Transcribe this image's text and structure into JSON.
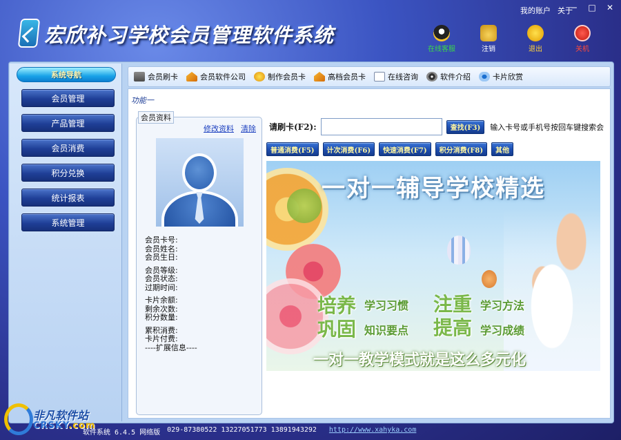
{
  "window": {
    "title": "宏欣补习学校会员管理软件系统",
    "links": [
      "我的账户",
      "关于"
    ],
    "controls": [
      "−",
      "□",
      "✕"
    ]
  },
  "top_actions": [
    {
      "label": "在线客服",
      "icon": "qq-penguin-icon",
      "color": "#3bd64a"
    },
    {
      "label": "注销",
      "icon": "lock-icon",
      "color": "#ffffff"
    },
    {
      "label": "退出",
      "icon": "running-man-icon",
      "color": "#ffd23a"
    },
    {
      "label": "关机",
      "icon": "power-icon",
      "color": "#ff4a3a"
    }
  ],
  "sidebar": {
    "header": "系统导航",
    "items": [
      "会员管理",
      "产品管理",
      "会员消费",
      "积分兑换",
      "统计报表",
      "系统管理"
    ]
  },
  "toolbar": {
    "items": [
      {
        "label": "会员刷卡",
        "icon": "card-reader-icon"
      },
      {
        "label": "会员软件公司",
        "icon": "house-icon"
      },
      {
        "label": "制作会员卡",
        "icon": "star-badge-icon"
      },
      {
        "label": "高档会员卡",
        "icon": "house-icon"
      },
      {
        "label": "在线咨询",
        "icon": "mail-icon"
      },
      {
        "label": "软件介绍",
        "icon": "disc-icon"
      },
      {
        "label": "卡片欣赏",
        "icon": "eye-icon"
      }
    ]
  },
  "content": {
    "function_label": "功能一",
    "member_panel": {
      "legend": "会员资料",
      "edit_link": "修改资料",
      "clear_link": "清除",
      "fields_group1": [
        "会员卡号:",
        "会员姓名:",
        "会员生日:"
      ],
      "fields_group2": [
        "会员等级:",
        "会员状态:",
        "过期时间:"
      ],
      "fields_group3": [
        "卡片余额:",
        "剩余次数:",
        "积分数量:"
      ],
      "fields_group4": [
        "累积消费:",
        "卡片付费:"
      ],
      "ext_info": "----扩展信息----"
    },
    "swipe": {
      "label": "请刷卡(F2):",
      "value": "",
      "query_button": "查找(F3)",
      "hint": "输入卡号或手机号按回车键搜索会"
    },
    "operations": [
      "普通消费(F5)",
      "计次消费(F6)",
      "快速消费(F7)",
      "积分消费(F8)",
      "其他"
    ],
    "banner": {
      "title": "一对一辅导学校精选",
      "slogans": [
        {
          "big": "培养",
          "small": "学习习惯"
        },
        {
          "big": "注重",
          "small": "学习方法"
        },
        {
          "big": "巩固",
          "small": "知识要点"
        },
        {
          "big": "提高",
          "small": "学习成绩"
        }
      ],
      "bottom": "一对一教学模式就是这么多元化"
    }
  },
  "status_bar": {
    "product": "软件系统 6.4.5 网络版",
    "phones": "029-87380522 13227051773 13891943292",
    "url": "http://www.xahyka.com"
  },
  "watermark": {
    "cn": "非凡软件站",
    "en_main": "CRSKY",
    "en_suffix": ".com"
  }
}
